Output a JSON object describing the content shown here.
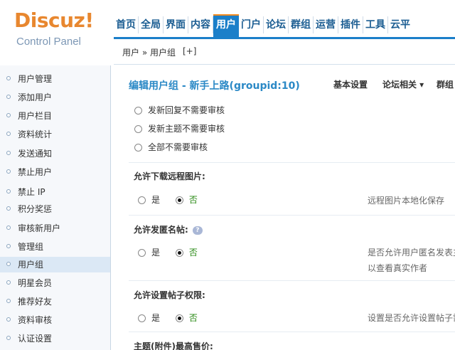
{
  "logo": {
    "main": "Discuz!",
    "sub": "Control Panel"
  },
  "nav": {
    "items": [
      "首页",
      "全局",
      "界面",
      "内容",
      "用户",
      "门户",
      "论坛",
      "群组",
      "运营",
      "插件",
      "工具",
      "云平"
    ],
    "active": "用户"
  },
  "breadcrumb": {
    "path": "用户 » 用户组",
    "add": "[+]"
  },
  "sidebar": {
    "items": [
      "用户管理",
      "添加用户",
      "用户栏目",
      "资料统计",
      "发送通知",
      "禁止用户",
      "禁止 IP",
      "积分奖惩",
      "审核新用户",
      "管理组",
      "用户组",
      "明星会员",
      "推荐好友",
      "资料审核",
      "认证设置"
    ],
    "active": "用户组"
  },
  "main": {
    "title": "编辑用户组 - 新手上路(groupid:10)",
    "tabs": [
      "基本设置",
      "论坛相关 ▾",
      "群组"
    ],
    "top_options": [
      "发新回复不需要审核",
      "发新主题不需要审核",
      "全部不需要审核"
    ],
    "sections": [
      {
        "label": "允许下载远程图片:",
        "yes": "是",
        "no": "否",
        "note": "远程图片本地化保存"
      },
      {
        "label": "允许发匿名帖:",
        "help": "?",
        "yes": "是",
        "no": "否",
        "note": "是否允许用户匿名发表主",
        "note2": "以查看真实作者"
      },
      {
        "label": "允许设置帖子权限:",
        "yes": "是",
        "no": "否",
        "note": "设置是否允许设置帖子需"
      },
      {
        "label": "主题(附件)最高售价:"
      }
    ]
  }
}
